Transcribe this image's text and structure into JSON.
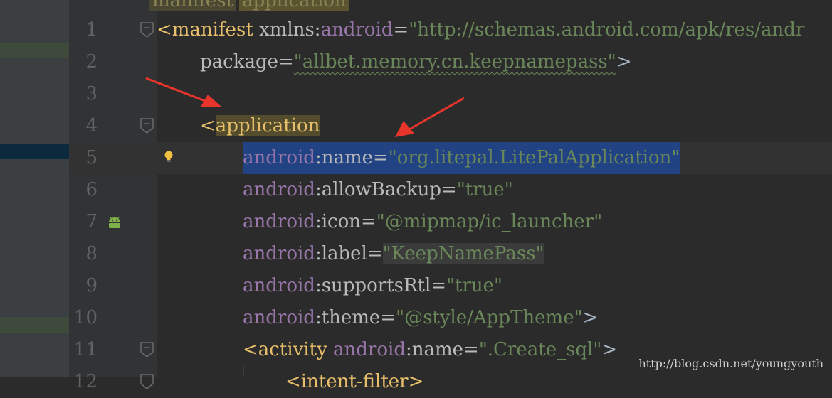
{
  "breadcrumb": {
    "items": [
      "manifest",
      "application"
    ]
  },
  "editor": {
    "lines": [
      {
        "num": "1"
      },
      {
        "num": "2"
      },
      {
        "num": "3"
      },
      {
        "num": "4"
      },
      {
        "num": "5"
      },
      {
        "num": "6"
      },
      {
        "num": "7"
      },
      {
        "num": "8"
      },
      {
        "num": "9"
      },
      {
        "num": "10"
      },
      {
        "num": "11"
      },
      {
        "num": "12"
      }
    ],
    "l1": {
      "open": "<manifest",
      "attr": " xmlns:",
      "ns": "android",
      "eq": "=",
      "value": "\"http://schemas.android.com/apk/res/andr"
    },
    "l2": {
      "attr": "package=",
      "value": "\"allbet.memory.cn.keepnamepass\"",
      "close": ">"
    },
    "l4": {
      "lt": "<",
      "tag": "application"
    },
    "l5": {
      "ns": "android",
      "attr": ":name=",
      "value": "\"org.litepal.LitePalApplication\""
    },
    "l6": {
      "ns": "android",
      "attr": ":allowBackup=",
      "value": "\"true\""
    },
    "l7": {
      "ns": "android",
      "attr": ":icon=",
      "value": "\"@mipmap/ic_launcher\""
    },
    "l8": {
      "ns": "android",
      "attr": ":label=",
      "value": "\"KeepNamePass\""
    },
    "l9": {
      "ns": "android",
      "attr": ":supportsRtl=",
      "value": "\"true\""
    },
    "l10": {
      "ns": "android",
      "attr": ":theme=",
      "value": "\"@style/AppTheme\"",
      "close": ">"
    },
    "l11": {
      "lt": "<",
      "tag": "activity",
      "ns": " android",
      "attr": ":name=",
      "value": "\".Create_sql\"",
      "close": ">"
    },
    "l12": {
      "text": "<intent-filter>"
    }
  },
  "watermark": "http://blog.csdn.net/youngyouth",
  "colors": {
    "background": "#2b2b2b",
    "tag": "#e8bf6a",
    "namespace": "#9876aa",
    "value": "#6a8759",
    "selection": "#214283",
    "arrow": "#e8352c"
  },
  "icons": [
    "fold-marker-icon",
    "lightbulb-icon",
    "android-icon",
    "annotation-arrow"
  ]
}
